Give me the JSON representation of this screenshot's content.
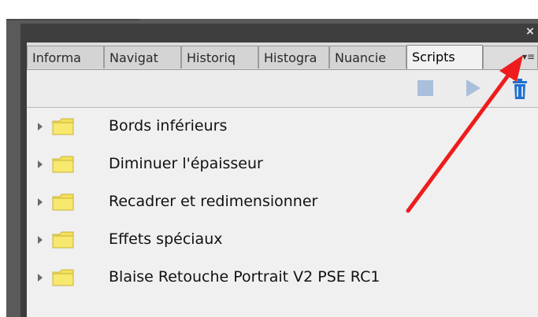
{
  "panel": {
    "close_label": "×",
    "menu_label": "▾≡"
  },
  "tabs": [
    {
      "label": "Informa"
    },
    {
      "label": "Navigat"
    },
    {
      "label": "Historiq"
    },
    {
      "label": "Histogra"
    },
    {
      "label": "Nuancie"
    },
    {
      "label": "Scripts"
    }
  ],
  "toolbar": {
    "stop_icon": "stop-icon",
    "play_icon": "play-icon",
    "trash_icon": "trash-icon",
    "accent": "#a9bfdc",
    "trash_color": "#1f6fd0"
  },
  "scripts": [
    {
      "label": "Bords inférieurs"
    },
    {
      "label": "Diminuer l'épaisseur"
    },
    {
      "label": "Recadrer et redimensionner"
    },
    {
      "label": "Effets spéciaux"
    },
    {
      "label": "Blaise Retouche Portrait V2 PSE RC1"
    }
  ],
  "annotation": {
    "color": "#ee1c1c"
  }
}
